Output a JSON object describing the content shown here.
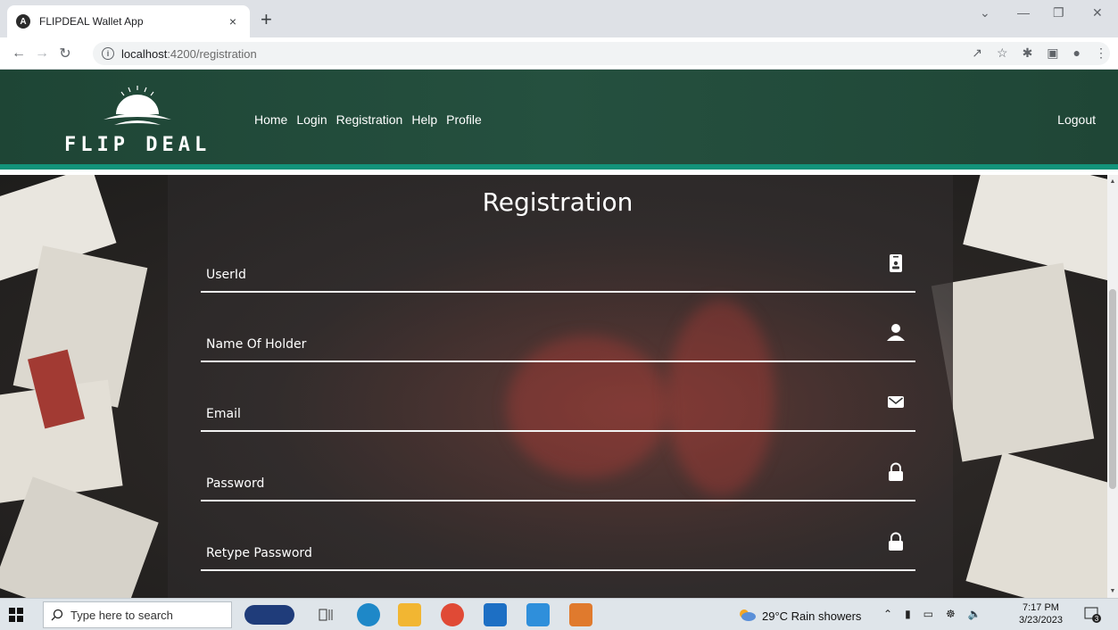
{
  "browser": {
    "tab_title": "FLIPDEAL Wallet App",
    "tab_close": "×",
    "new_tab": "+",
    "url_host": "localhost",
    "url_path": ":4200/registration"
  },
  "header": {
    "logo_text": "FLIP DEAL",
    "nav": [
      "Home",
      "Login",
      "Registration",
      "Help",
      "Profile"
    ],
    "logout": "Logout",
    "colors": {
      "header_bg": "#25503f",
      "accent_border": "#12937a"
    }
  },
  "form": {
    "title": "Registration",
    "fields": [
      {
        "label": "UserId",
        "icon": "id-card-icon"
      },
      {
        "label": "Name Of Holder",
        "icon": "user-icon"
      },
      {
        "label": "Email",
        "icon": "envelope-icon"
      },
      {
        "label": "Password",
        "icon": "lock-icon"
      },
      {
        "label": "Retype Password",
        "icon": "lock-icon"
      }
    ]
  },
  "taskbar": {
    "search_placeholder": "Type here to search",
    "weather": "29°C  Rain showers",
    "time": "7:17 PM",
    "date": "3/23/2023",
    "notifications": "3"
  }
}
